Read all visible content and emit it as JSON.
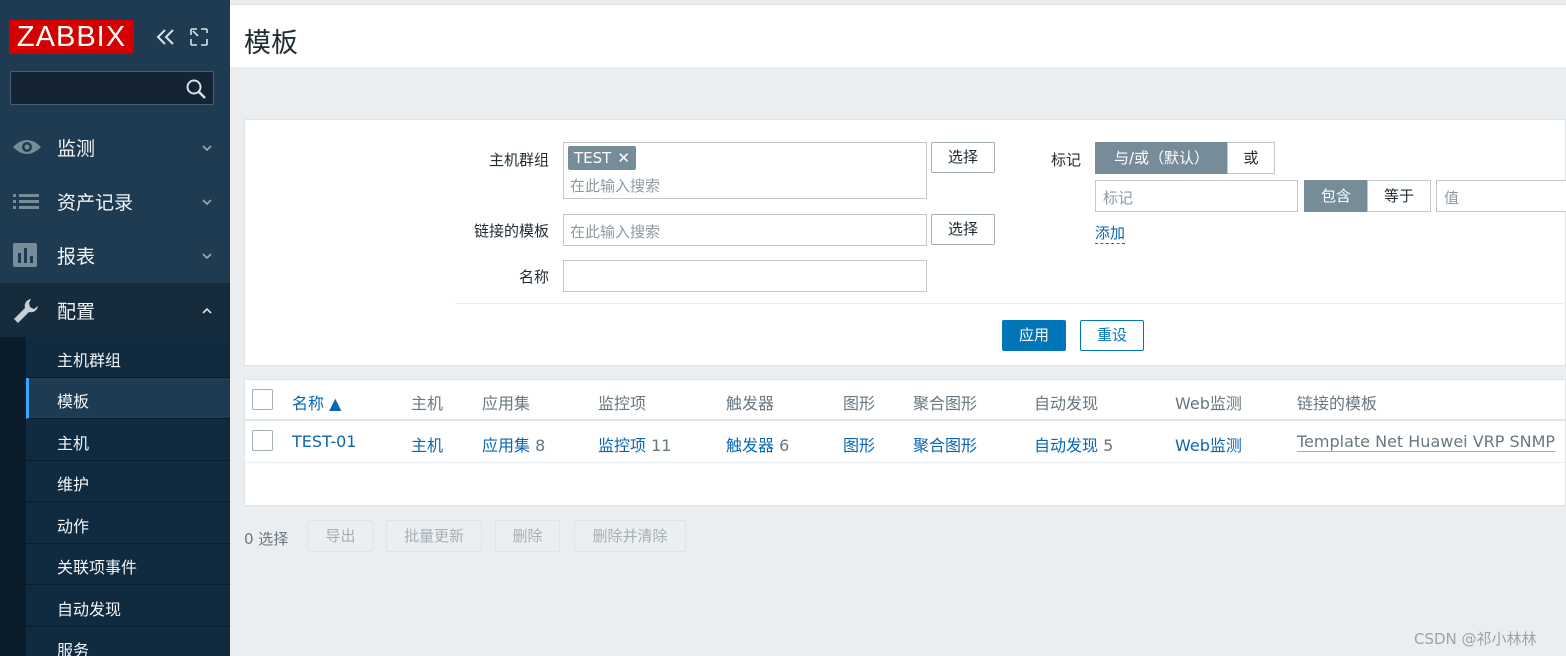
{
  "sidebar": {
    "logo": "ZABBIX",
    "menu": [
      {
        "label": "监测",
        "icon": "eye-icon"
      },
      {
        "label": "资产记录",
        "icon": "list-icon"
      },
      {
        "label": "报表",
        "icon": "bar-chart-icon"
      },
      {
        "label": "配置",
        "icon": "wrench-icon"
      }
    ],
    "submenu": [
      "主机群组",
      "模板",
      "主机",
      "维护",
      "动作",
      "关联项事件",
      "自动发现",
      "服务"
    ],
    "active_submenu": "模板"
  },
  "header": {
    "title": "模板"
  },
  "filter": {
    "host_groups_label": "主机群组",
    "host_group_chip": "TEST",
    "search_placeholder": "在此输入搜索",
    "select_label": "选择",
    "linked_templates_label": "链接的模板",
    "name_label": "名称",
    "name_value": "",
    "tags_label": "标记",
    "tag_and_or": "与/或（默认）",
    "tag_or": "或",
    "tag_placeholder": "标记",
    "contains": "包含",
    "equals": "等于",
    "value_placeholder": "值",
    "add_label": "添加",
    "apply_label": "应用",
    "reset_label": "重设"
  },
  "table": {
    "headers": [
      "名称 ▲",
      "主机",
      "应用集",
      "监控项",
      "触发器",
      "图形",
      "聚合图形",
      "自动发现",
      "Web监测",
      "链接的模板"
    ],
    "rows": [
      {
        "name": "TEST-01",
        "hosts": "主机",
        "applications": "应用集",
        "applications_count": "8",
        "items": "监控项",
        "items_count": "11",
        "triggers": "触发器",
        "triggers_count": "6",
        "graphs": "图形",
        "screens": "聚合图形",
        "discovery": "自动发现",
        "discovery_count": "5",
        "web": "Web监测",
        "linked_template": "Template Net Huawei VRP SNMP"
      }
    ]
  },
  "actions": {
    "selected": "0 选择",
    "export": "导出",
    "mass_update": "批量更新",
    "delete": "删除",
    "delete_clear": "删除并清除"
  },
  "watermark": "CSDN @祁小林林"
}
